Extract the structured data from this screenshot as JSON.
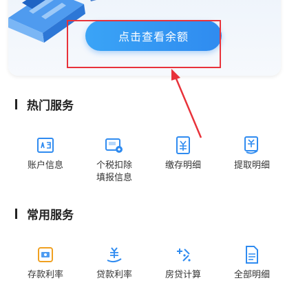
{
  "banner": {
    "check_balance_label": "点击查看余额"
  },
  "hot_services": {
    "title": "热门服务",
    "items": [
      {
        "label": "账户信息",
        "icon": "account-info-icon"
      },
      {
        "label": "个税扣除填报信息",
        "icon": "tax-report-icon"
      },
      {
        "label": "缴存明细",
        "icon": "deposit-details-icon"
      },
      {
        "label": "提取明细",
        "icon": "withdrawal-details-icon"
      }
    ]
  },
  "common_services": {
    "title": "常用服务",
    "items": [
      {
        "label": "存款利率",
        "icon": "deposit-rate-icon"
      },
      {
        "label": "贷款利率",
        "icon": "loan-rate-icon"
      },
      {
        "label": "房贷计算",
        "icon": "mortgage-calc-icon"
      },
      {
        "label": "全部明细",
        "icon": "all-details-icon"
      }
    ]
  },
  "colors": {
    "accent": "#2f8bf0",
    "annotation": "#e8323a"
  }
}
